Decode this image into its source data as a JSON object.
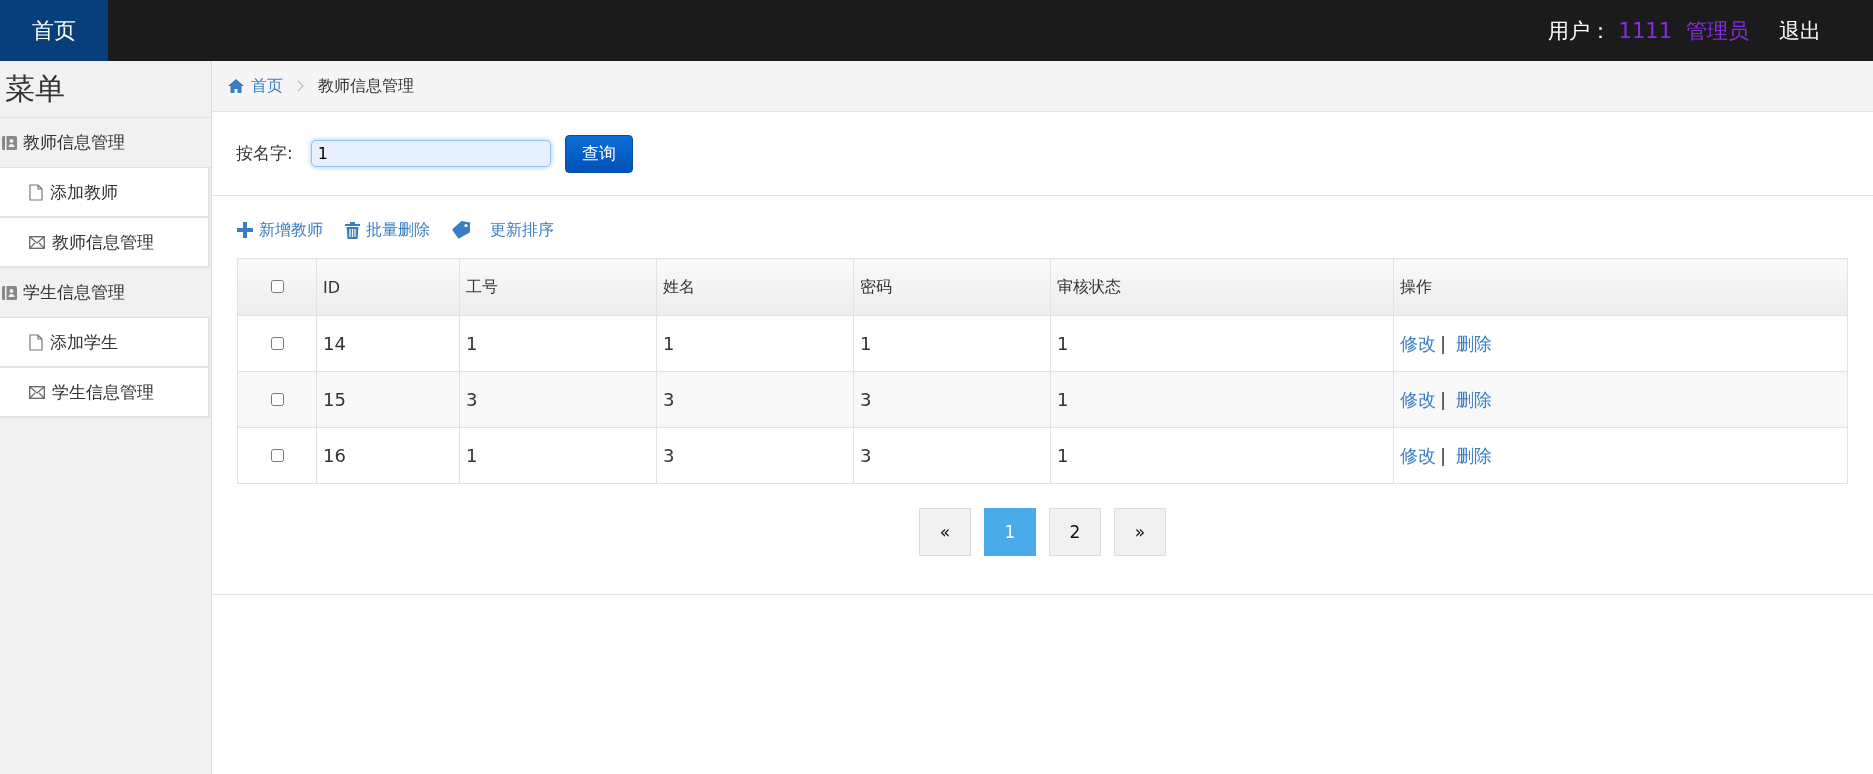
{
  "header": {
    "home": "首页",
    "user_label": "用户：",
    "user_id": "1111",
    "role": "管理员",
    "logout": "退出"
  },
  "sidebar": {
    "title": "菜单",
    "groups": [
      {
        "label": "教师信息管理",
        "children": [
          {
            "label": "添加教师",
            "kind": "file"
          },
          {
            "label": "教师信息管理",
            "kind": "mail"
          }
        ]
      },
      {
        "label": "学生信息管理",
        "children": [
          {
            "label": "添加学生",
            "kind": "file"
          },
          {
            "label": "学生信息管理",
            "kind": "mail"
          }
        ]
      }
    ]
  },
  "breadcrumb": {
    "home": "首页",
    "current": "教师信息管理"
  },
  "search": {
    "label": "按名字:",
    "value": "1",
    "button": "查询"
  },
  "toolbar": [
    {
      "label": "新增教师",
      "kind": "plus"
    },
    {
      "label": "批量删除",
      "kind": "trash"
    },
    {
      "label": "更新排序",
      "kind": "tag"
    }
  ],
  "table": {
    "columns": [
      "ID",
      "工号",
      "姓名",
      "密码",
      "审核状态",
      "操作"
    ],
    "header_checked": false,
    "rows": [
      {
        "checked": false,
        "cells": [
          "14",
          "1",
          "1",
          "1",
          "1"
        ],
        "actions": [
          "修改",
          "|",
          "删除"
        ]
      },
      {
        "checked": false,
        "cells": [
          "15",
          "3",
          "3",
          "3",
          "1"
        ],
        "actions": [
          "修改",
          "|",
          "删除"
        ]
      },
      {
        "checked": false,
        "cells": [
          "16",
          "1",
          "3",
          "3",
          "1"
        ],
        "actions": [
          "修改",
          "|",
          "删除"
        ]
      }
    ]
  },
  "pagination": [
    {
      "label": "«",
      "selected": false
    },
    {
      "label": "1",
      "selected": true
    },
    {
      "label": "2",
      "selected": false
    },
    {
      "label": "»",
      "selected": false
    }
  ]
}
